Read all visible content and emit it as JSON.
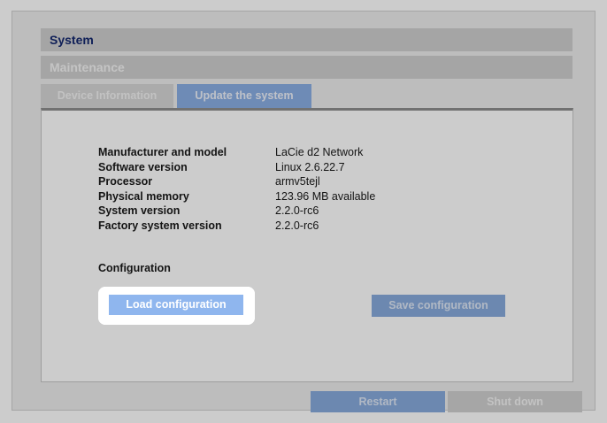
{
  "header": {
    "section_title": "System",
    "subsection_title": "Maintenance"
  },
  "tabs": [
    {
      "label": "Device Information",
      "active": false
    },
    {
      "label": "Update the system",
      "active": true
    }
  ],
  "device_info": [
    {
      "key": "Manufacturer and model",
      "value": "LaCie d2 Network"
    },
    {
      "key": "Software version",
      "value": "Linux 2.6.22.7"
    },
    {
      "key": "Processor",
      "value": "armv5tejl"
    },
    {
      "key": "Physical memory",
      "value": "123.96 MB available"
    },
    {
      "key": "System version",
      "value": "2.2.0-rc6"
    },
    {
      "key": "Factory system version",
      "value": "2.2.0-rc6"
    }
  ],
  "configuration": {
    "heading": "Configuration",
    "load_label": "Load configuration",
    "save_label": "Save configuration"
  },
  "footer": {
    "restart_label": "Restart",
    "shutdown_label": "Shut down"
  },
  "colors": {
    "title_text": "#14286e",
    "active_tab": "#8aaee4",
    "button_blue": "#8fb6ee",
    "panel_border": "#8e8e8e"
  }
}
